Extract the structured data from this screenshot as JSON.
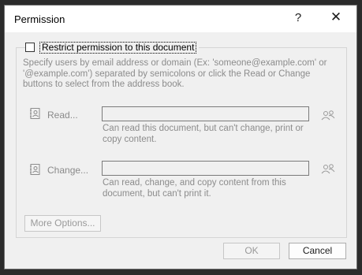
{
  "window": {
    "title": "Permission",
    "help_glyph": "?",
    "close_glyph": "✕"
  },
  "restrict": {
    "label": "Restrict permission to this document",
    "checked": false
  },
  "instructions": "Specify users by email address or domain (Ex: 'someone@example.com' or '@example.com') separated by semicolons or click the Read or Change buttons to select from the address book.",
  "read": {
    "label": "Read...",
    "value": "",
    "description": "Can read this document, but can't change, print or copy content."
  },
  "change": {
    "label": "Change...",
    "value": "",
    "description": "Can read, change, and copy content from this document, but can't print it."
  },
  "buttons": {
    "more_options": "More Options...",
    "ok": "OK",
    "cancel": "Cancel"
  },
  "icons": {
    "read_book": "address-book-icon",
    "change_book": "address-book-icon",
    "read_people": "people-icon",
    "change_people": "people-icon"
  }
}
